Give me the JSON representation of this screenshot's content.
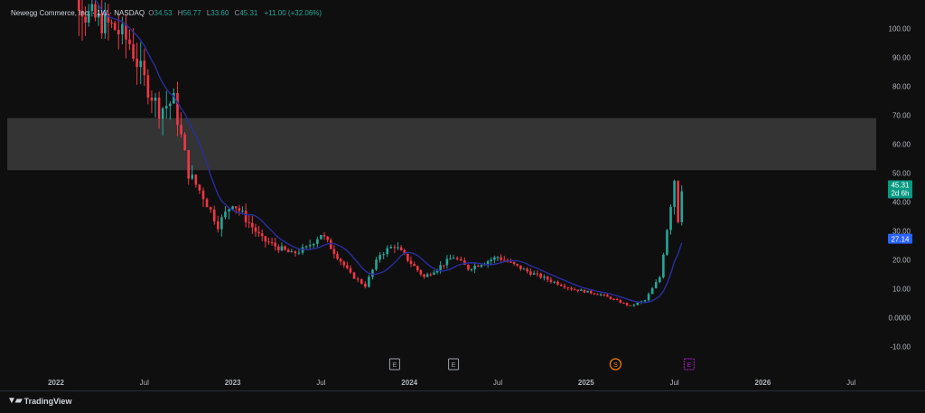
{
  "header": {
    "symbol": "Newegg Commerce, Inc. · 1W · NASDAQ",
    "open_label": "O",
    "open": "34.53",
    "high_label": "H",
    "high": "56.77",
    "low_label": "L",
    "low": "33.60",
    "close_label": "C",
    "close": "45.31",
    "change": "+11.00 (+32.06%)"
  },
  "price_tag": {
    "price": "45.31",
    "countdown": "2d 6h"
  },
  "ma_tag": "27.14",
  "brand": "TradingView",
  "colors": {
    "up": "#26a69a",
    "down": "#f23645",
    "ma": "#2a2e9e",
    "zone": "#3b3b3b",
    "tag_ma": "#2962ff",
    "tag_price": "#089981",
    "earn": "#9ea1a9",
    "div": "#f57c00",
    "future": "#b11fd3"
  },
  "chart_data": {
    "type": "candlestick",
    "interval": "1W",
    "y_ticks": [
      "100.00",
      "90.00",
      "80.00",
      "70.00",
      "60.00",
      "50.00",
      "40.00",
      "30.00",
      "20.00",
      "10.00",
      "0.0000",
      "-10.00"
    ],
    "ylim": [
      -12,
      104
    ],
    "x_ticks": [
      "2022",
      "Jul",
      "2023",
      "Jul",
      "2024",
      "Jul",
      "2025",
      "Jul",
      "2026",
      "Jul"
    ],
    "zone": {
      "from": 51,
      "to": 69
    },
    "events": [
      {
        "kind": "earnings",
        "label": "E",
        "date": "2023-12"
      },
      {
        "kind": "earnings",
        "label": "E",
        "date": "2024-04"
      },
      {
        "kind": "dividend",
        "label": "S",
        "date": "2025-03"
      },
      {
        "kind": "upcoming",
        "label": "E",
        "date": "2025-08"
      }
    ],
    "anchors": [
      {
        "date": "2022-01",
        "close": 130
      },
      {
        "date": "2022-03",
        "close": 105
      },
      {
        "date": "2022-05",
        "close": 100
      },
      {
        "date": "2022-06",
        "close": 95
      },
      {
        "date": "2022-07",
        "close": 82
      },
      {
        "date": "2022-08",
        "close": 72
      },
      {
        "date": "2022-09",
        "close": 75
      },
      {
        "date": "2022-10",
        "close": 50
      },
      {
        "date": "2022-11",
        "close": 42
      },
      {
        "date": "2022-12",
        "close": 32
      },
      {
        "date": "2023-01",
        "close": 40
      },
      {
        "date": "2023-03",
        "close": 27
      },
      {
        "date": "2023-05",
        "close": 22
      },
      {
        "date": "2023-06",
        "close": 24
      },
      {
        "date": "2023-07",
        "close": 29
      },
      {
        "date": "2023-09",
        "close": 15
      },
      {
        "date": "2023-10",
        "close": 11
      },
      {
        "date": "2023-11",
        "close": 22
      },
      {
        "date": "2023-12",
        "close": 25
      },
      {
        "date": "2024-02",
        "close": 14
      },
      {
        "date": "2024-04",
        "close": 21
      },
      {
        "date": "2024-05",
        "close": 17
      },
      {
        "date": "2024-07",
        "close": 21
      },
      {
        "date": "2024-09",
        "close": 16
      },
      {
        "date": "2024-12",
        "close": 10
      },
      {
        "date": "2025-02",
        "close": 8
      },
      {
        "date": "2025-04",
        "close": 4
      },
      {
        "date": "2025-05",
        "close": 6
      },
      {
        "date": "2025-06",
        "close": 14
      },
      {
        "date": "2025-07",
        "close": 48
      },
      {
        "date": "2025-07",
        "close": 34
      },
      {
        "date": "2025-07",
        "close": 45.31
      }
    ]
  }
}
